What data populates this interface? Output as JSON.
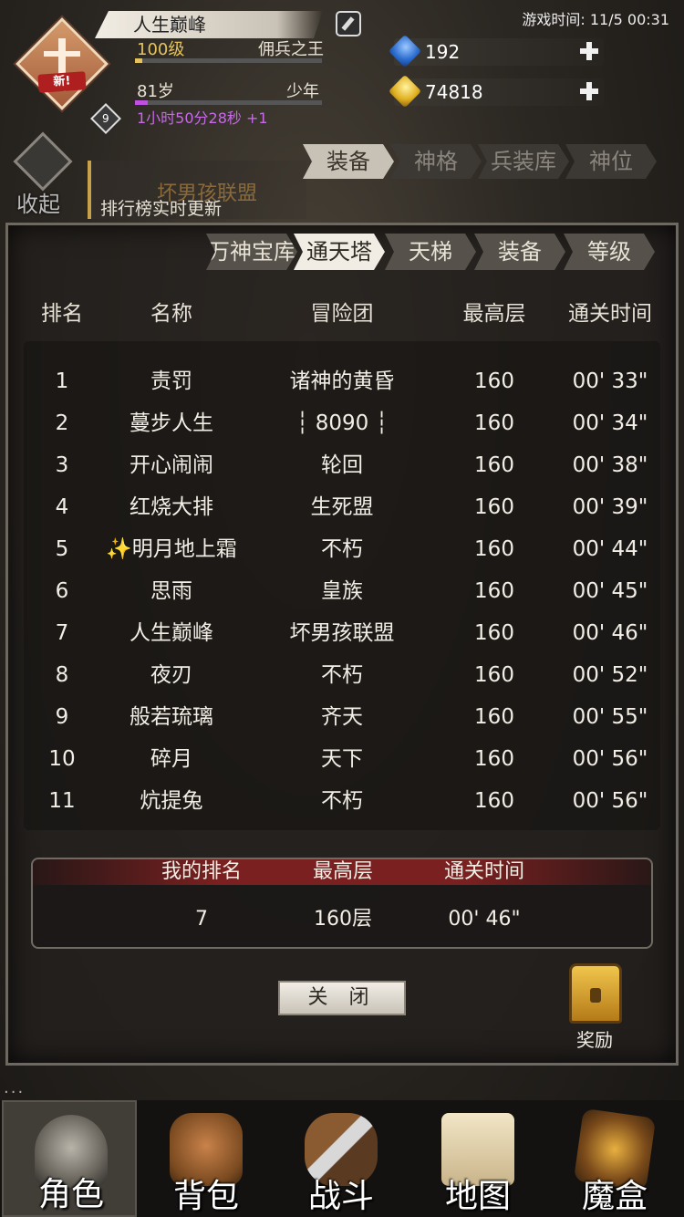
{
  "player": {
    "name": "人生巅峰",
    "level": "100级",
    "title": "佣兵之王",
    "age": "81岁",
    "stage": "少年",
    "timer": "1小时50分28秒 +1",
    "new_badge": "新!",
    "rank_badge": "9"
  },
  "game_time": "游戏时间: 11/5 00:31",
  "currency": {
    "gems": "192",
    "gold": "74818"
  },
  "collapse_label": "收起",
  "guild": {
    "name": "坏男孩联盟",
    "ticker": "排行榜实时更新"
  },
  "top_tabs": [
    "装备",
    "神格",
    "兵装库",
    "神位"
  ],
  "sub_tabs": [
    "万神宝库",
    "通天塔",
    "天梯",
    "装备",
    "等级"
  ],
  "columns": {
    "rank": "排名",
    "name": "名称",
    "team": "冒险团",
    "floor": "最高层",
    "time": "通关时间"
  },
  "rows": [
    {
      "rank": "1",
      "name": "责罚",
      "team": "诸神的黄昏",
      "floor": "160",
      "time": "00' 33\""
    },
    {
      "rank": "2",
      "name": "蔓步人生",
      "team": "┆ 8090 ┆",
      "floor": "160",
      "time": "00' 34\""
    },
    {
      "rank": "3",
      "name": "开心闹闹",
      "team": "轮回",
      "floor": "160",
      "time": "00' 38\""
    },
    {
      "rank": "4",
      "name": "红烧大排",
      "team": "生死盟",
      "floor": "160",
      "time": "00' 39\""
    },
    {
      "rank": "5",
      "name": "✨明月地上霜",
      "team": "不朽",
      "floor": "160",
      "time": "00' 44\""
    },
    {
      "rank": "6",
      "name": "思雨",
      "team": "皇族",
      "floor": "160",
      "time": "00' 45\""
    },
    {
      "rank": "7",
      "name": "人生巅峰",
      "team": "坏男孩联盟",
      "floor": "160",
      "time": "00' 46\""
    },
    {
      "rank": "8",
      "name": "夜刃",
      "team": "不朽",
      "floor": "160",
      "time": "00' 52\""
    },
    {
      "rank": "9",
      "name": "般若琉璃",
      "team": "齐天",
      "floor": "160",
      "time": "00' 55\""
    },
    {
      "rank": "10",
      "name": "碎月",
      "team": "天下",
      "floor": "160",
      "time": "00' 56\""
    },
    {
      "rank": "11",
      "name": "炕提兔",
      "team": "不朽",
      "floor": "160",
      "time": "00' 56\""
    }
  ],
  "my_rank": {
    "rank_label": "我的排名",
    "floor_label": "最高层",
    "time_label": "通关时间",
    "rank": "7",
    "floor": "160层",
    "time": "00' 46\""
  },
  "close_label": "关 闭",
  "reward_label": "奖励",
  "dots": "...",
  "nav": [
    "角色",
    "背包",
    "战斗",
    "地图",
    "魔盒"
  ]
}
